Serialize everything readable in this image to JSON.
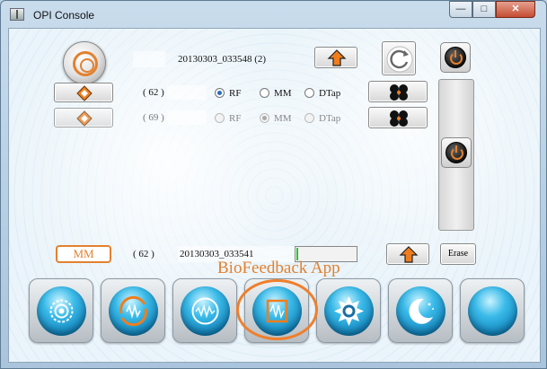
{
  "window": {
    "title": "OPI Console"
  },
  "controls": {
    "minimize": "—",
    "maximize": "□",
    "close": "✕"
  },
  "session": {
    "top_recording": "20130303_033548 (2)",
    "bottom_recording": "20130303_033541"
  },
  "channels": [
    {
      "count": "( 62 )",
      "modes": [
        "RF",
        "MM",
        "DTap"
      ],
      "selected": "RF",
      "enabled": true
    },
    {
      "count": "( 69 )",
      "modes": [
        "RF",
        "MM",
        "DTap"
      ],
      "selected": "MM",
      "enabled": false
    }
  ],
  "player": {
    "mode_badge": "MM",
    "count": "( 62 )",
    "progress": 0.03
  },
  "buttons": {
    "erase": "Erase"
  },
  "annotation": {
    "label": "BioFeedback App"
  },
  "bottom_bar": [
    {
      "icon": "gear-icon"
    },
    {
      "icon": "sync-waveform-icon"
    },
    {
      "icon": "waveform-circle-icon"
    },
    {
      "icon": "biofeedback-icon"
    },
    {
      "icon": "sun-icon"
    },
    {
      "icon": "moon-icon"
    },
    {
      "icon": "blank-orb-icon"
    }
  ],
  "colors": {
    "accent": "#e2812f",
    "orb": "#1a9fd8",
    "progress": "#2fbf3a"
  }
}
